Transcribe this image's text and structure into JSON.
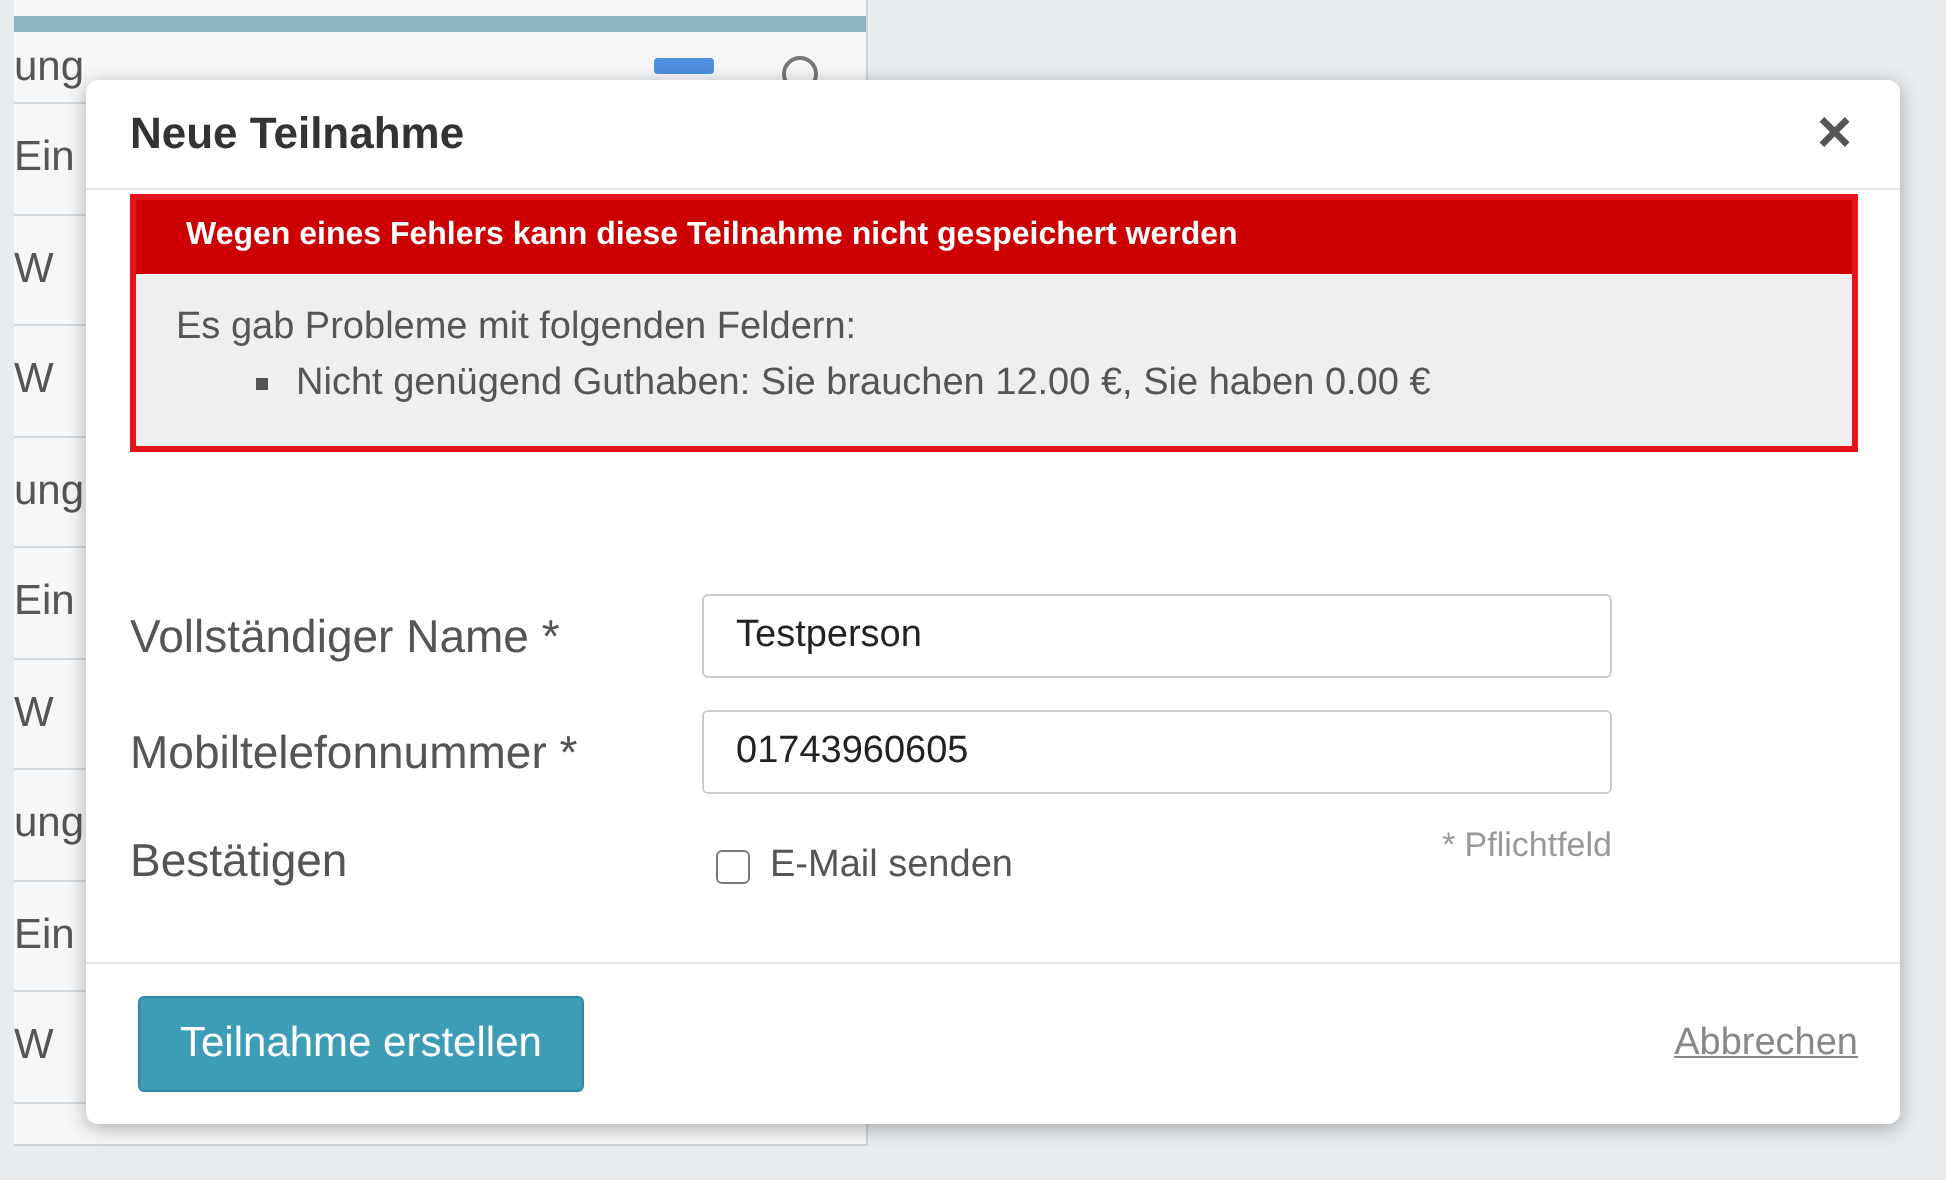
{
  "background_table": {
    "rows": [
      {
        "text": "ung"
      },
      {
        "text": "Ein"
      },
      {
        "text": "W"
      },
      {
        "text": "W"
      },
      {
        "text": "ung"
      },
      {
        "text": "Ein"
      },
      {
        "text": "W"
      },
      {
        "text": "ung"
      },
      {
        "text": "Ein"
      },
      {
        "text": "W"
      }
    ]
  },
  "dialog": {
    "title": "Neue Teilnahme",
    "close": "×",
    "error": {
      "heading": "Wegen eines Fehlers kann diese Teilnahme nicht gespeichert werden",
      "intro": "Es gab Probleme mit folgenden Feldern:",
      "items": [
        "Nicht genügend Guthaben: Sie brauchen 12.00 €, Sie haben 0.00 €"
      ]
    },
    "fields": [
      {
        "label": "Vollständiger Name *",
        "value": "Testperson"
      },
      {
        "label": "Mobiltelefonnummer *",
        "value": "01743960605"
      }
    ],
    "confirm": {
      "label": "Bestätigen",
      "checkbox": {
        "label": "E-Mail senden",
        "checked": false
      },
      "required_note": "* Pflichtfeld"
    },
    "buttons": {
      "submit": "Teilnahme erstellen",
      "cancel": "Abbrechen"
    }
  }
}
